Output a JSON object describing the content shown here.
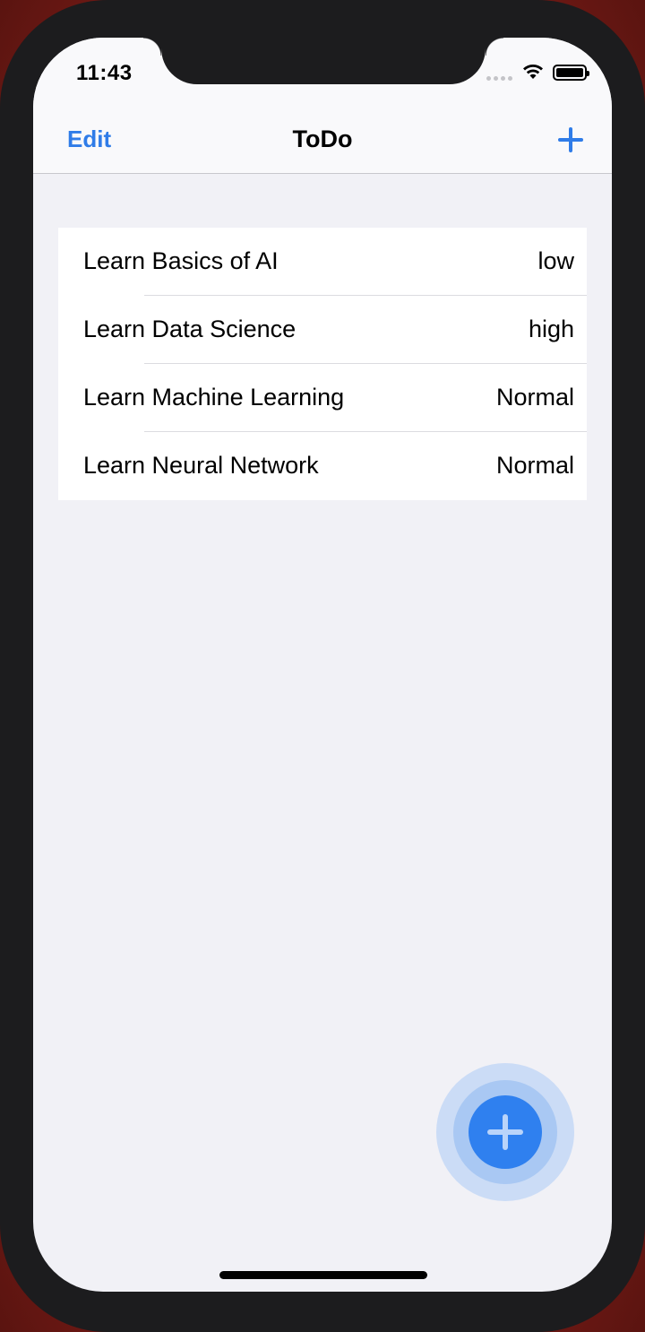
{
  "status_bar": {
    "time": "11:43"
  },
  "nav": {
    "edit_label": "Edit",
    "title": "ToDo",
    "add_icon": "plus-icon"
  },
  "todos": [
    {
      "title": "Learn Basics of AI",
      "priority": "low"
    },
    {
      "title": "Learn Data Science",
      "priority": "high"
    },
    {
      "title": "Learn Machine Learning",
      "priority": "Normal"
    },
    {
      "title": "Learn Neural Network",
      "priority": "Normal"
    }
  ],
  "fab": {
    "icon": "plus-icon"
  },
  "colors": {
    "accent": "#2f7ce8",
    "background": "#f1f1f6",
    "fab": "#2f80ef"
  }
}
